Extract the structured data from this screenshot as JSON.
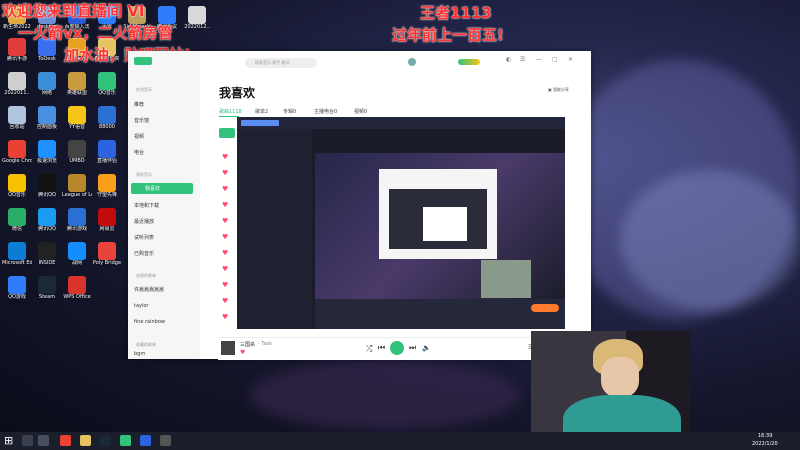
{
  "overlay": {
    "left_line1": "欢迎您来到直播间 VI",
    "left_line2": "一火箭vx，二火箭房管",
    "left_line3": "加水油，贴吧回帖!",
    "right_line1": "王者1113",
    "right_line2": "过年前上一百五!"
  },
  "desktop_icons": [
    {
      "label": "新生命2022",
      "color": "#e0aa3e"
    },
    {
      "label": "desktop",
      "color": "#6b8fd6"
    },
    {
      "label": "百度输入法",
      "color": "#2a5bd7"
    },
    {
      "label": "迅雷",
      "color": "#2b7bff"
    },
    {
      "label": "Sid Meier's",
      "color": "#c0a060"
    },
    {
      "label": "腾讯会议",
      "color": "#2f7dfb"
    },
    {
      "label": "2022012..",
      "color": "#d9d9d9"
    },
    {
      "label": "腾讯手游",
      "color": "#e03c3c"
    },
    {
      "label": "ToDesk",
      "color": "#3a6ff0"
    },
    {
      "label": "WeGame",
      "color": "#e8a020"
    },
    {
      "label": "新建文件夹",
      "color": "#e6c260"
    },
    {
      "label": "2022011..",
      "color": "#cfcfcf"
    },
    {
      "label": "网络",
      "color": "#3a8fd8"
    },
    {
      "label": "英雄联盟",
      "color": "#c89b3c"
    },
    {
      "label": "QQ音乐",
      "color": "#31c27c"
    },
    {
      "label": "回收站",
      "color": "#b0c4de"
    },
    {
      "label": "控制面板",
      "color": "#4a90e2"
    },
    {
      "label": "YY语音",
      "color": "#f5c518"
    },
    {
      "label": "88000",
      "color": "#2a6fd1"
    },
    {
      "label": "Google Chrome",
      "color": "#e94235"
    },
    {
      "label": "极速浏览",
      "color": "#1e90ff"
    },
    {
      "label": "UMBO",
      "color": "#444444"
    },
    {
      "label": "直播伴侣",
      "color": "#2d62e0"
    },
    {
      "label": "QQ音乐",
      "color": "#f7c100"
    },
    {
      "label": "腾讯QQ",
      "color": "#111111"
    },
    {
      "label": "League of Legends",
      "color": "#b8872b"
    },
    {
      "label": "守望先锋",
      "color": "#f99e1a"
    },
    {
      "label": "微信",
      "color": "#2aae67"
    },
    {
      "label": "腾讯QQ",
      "color": "#1a9cf0"
    },
    {
      "label": "腾讯游戏",
      "color": "#2a6fd1"
    },
    {
      "label": "网易云",
      "color": "#c20c0c"
    },
    {
      "label": "Microsoft Edge",
      "color": "#0c7cd5"
    },
    {
      "label": "INSIDE",
      "color": "#222222"
    },
    {
      "label": "战网",
      "color": "#148eff"
    },
    {
      "label": "Poly Bridge",
      "color": "#e8443a"
    },
    {
      "label": "QQ游戏",
      "color": "#2f7dfb"
    },
    {
      "label": "Steam",
      "color": "#1b2838"
    },
    {
      "label": "WPS Office",
      "color": "#d9332b"
    }
  ],
  "window": {
    "title": "我喜欢",
    "search_placeholder": "搜索音乐 歌手 歌词",
    "smart_play": "智能分享",
    "tabs": [
      "歌曲1118",
      "歌单2",
      "专辑0",
      "主播电台0",
      "视频0"
    ],
    "sidebar": {
      "section1": "在线音乐",
      "items1": [
        "推荐",
        "音乐馆",
        "视频",
        "电台"
      ],
      "section2": "我的音乐",
      "items2": [
        "我喜欢",
        "本地和下载",
        "最近播放",
        "试听列表",
        "已购音乐"
      ],
      "section3": "创建的歌单",
      "items3": [
        "许嵩嵩嵩嵩嵩",
        "taylor",
        "fine rainbow"
      ],
      "section4": "收藏的歌单",
      "items4": [
        "bgm"
      ]
    }
  },
  "player": {
    "song": "三国杀",
    "artist": "- Task"
  },
  "clock": {
    "time": "16:39",
    "date": "2022/1/20"
  },
  "colors": {
    "accent": "#31c27c",
    "overlay_red": "#ff3030",
    "heart": "#ff4d6d"
  }
}
